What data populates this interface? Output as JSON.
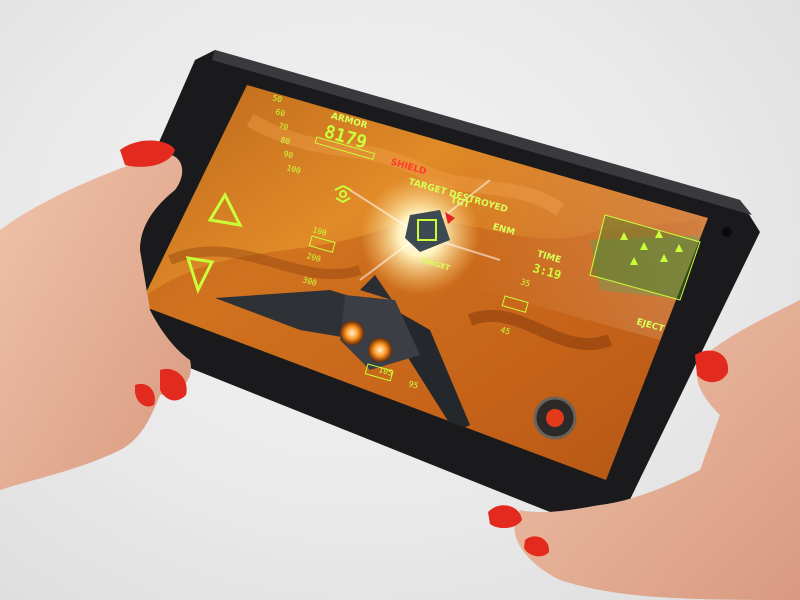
{
  "game": {
    "armor_label": "ARMOR",
    "armor_value": "8179",
    "shield_label": "SHIELD",
    "tgt_label": "TGT",
    "enm_label": "ENM",
    "time_label": "TIME",
    "time_value": "3:19",
    "target_message": "TARGET DESTROYED",
    "target_tag": "TARGET",
    "eject_label": "EJECT",
    "pitch_ladder": [
      "50",
      "60",
      "70",
      "80",
      "90",
      "100"
    ],
    "altitude_readouts": [
      "100",
      "200",
      "300"
    ],
    "speed_readouts": [
      "35",
      "45"
    ],
    "compass_readouts": [
      "105",
      "95"
    ]
  },
  "colors": {
    "hud": "#c9ff3a",
    "nail": "#e32a1e",
    "tablet_bezel": "#1a1a1c"
  }
}
